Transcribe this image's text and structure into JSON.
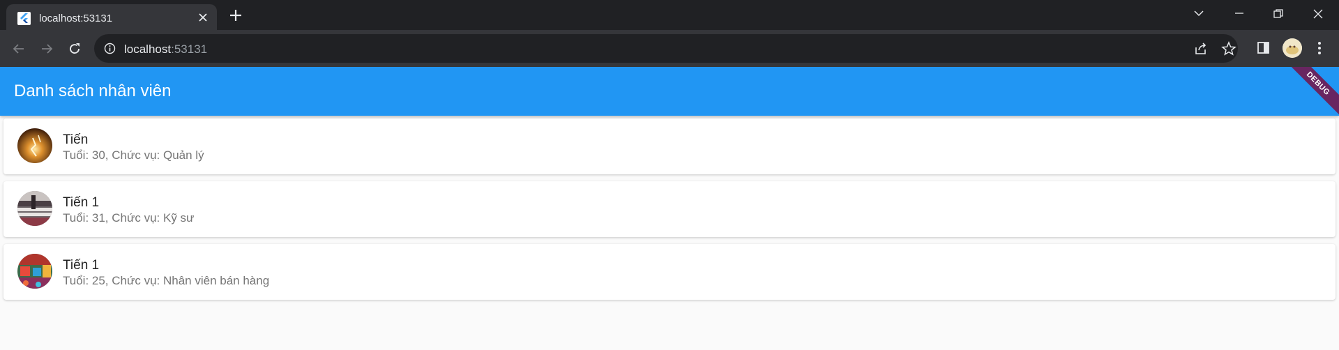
{
  "browser": {
    "tab": {
      "title": "localhost:53131",
      "favicon": "flutter-icon"
    },
    "url": {
      "host": "localhost",
      "port": ":53131"
    },
    "colors": {
      "tabbar": "#202124",
      "toolbar": "#35363a",
      "omnibox": "#202124"
    }
  },
  "app": {
    "title": "Danh sách nhân viên",
    "debug_label": "DEBUG",
    "colors": {
      "appbar": "#2196f3",
      "background": "#fafafa"
    },
    "employees": [
      {
        "name": "Tiến",
        "subtitle": "Tuổi: 30, Chức vụ: Quản lý",
        "avatar": "avatar-fire"
      },
      {
        "name": "Tiến 1",
        "subtitle": "Tuổi: 31, Chức vụ: Kỹ sư",
        "avatar": "avatar-street"
      },
      {
        "name": "Tiến 1",
        "subtitle": "Tuổi: 25, Chức vụ: Nhân viên bán hàng",
        "avatar": "avatar-colorful"
      }
    ]
  }
}
